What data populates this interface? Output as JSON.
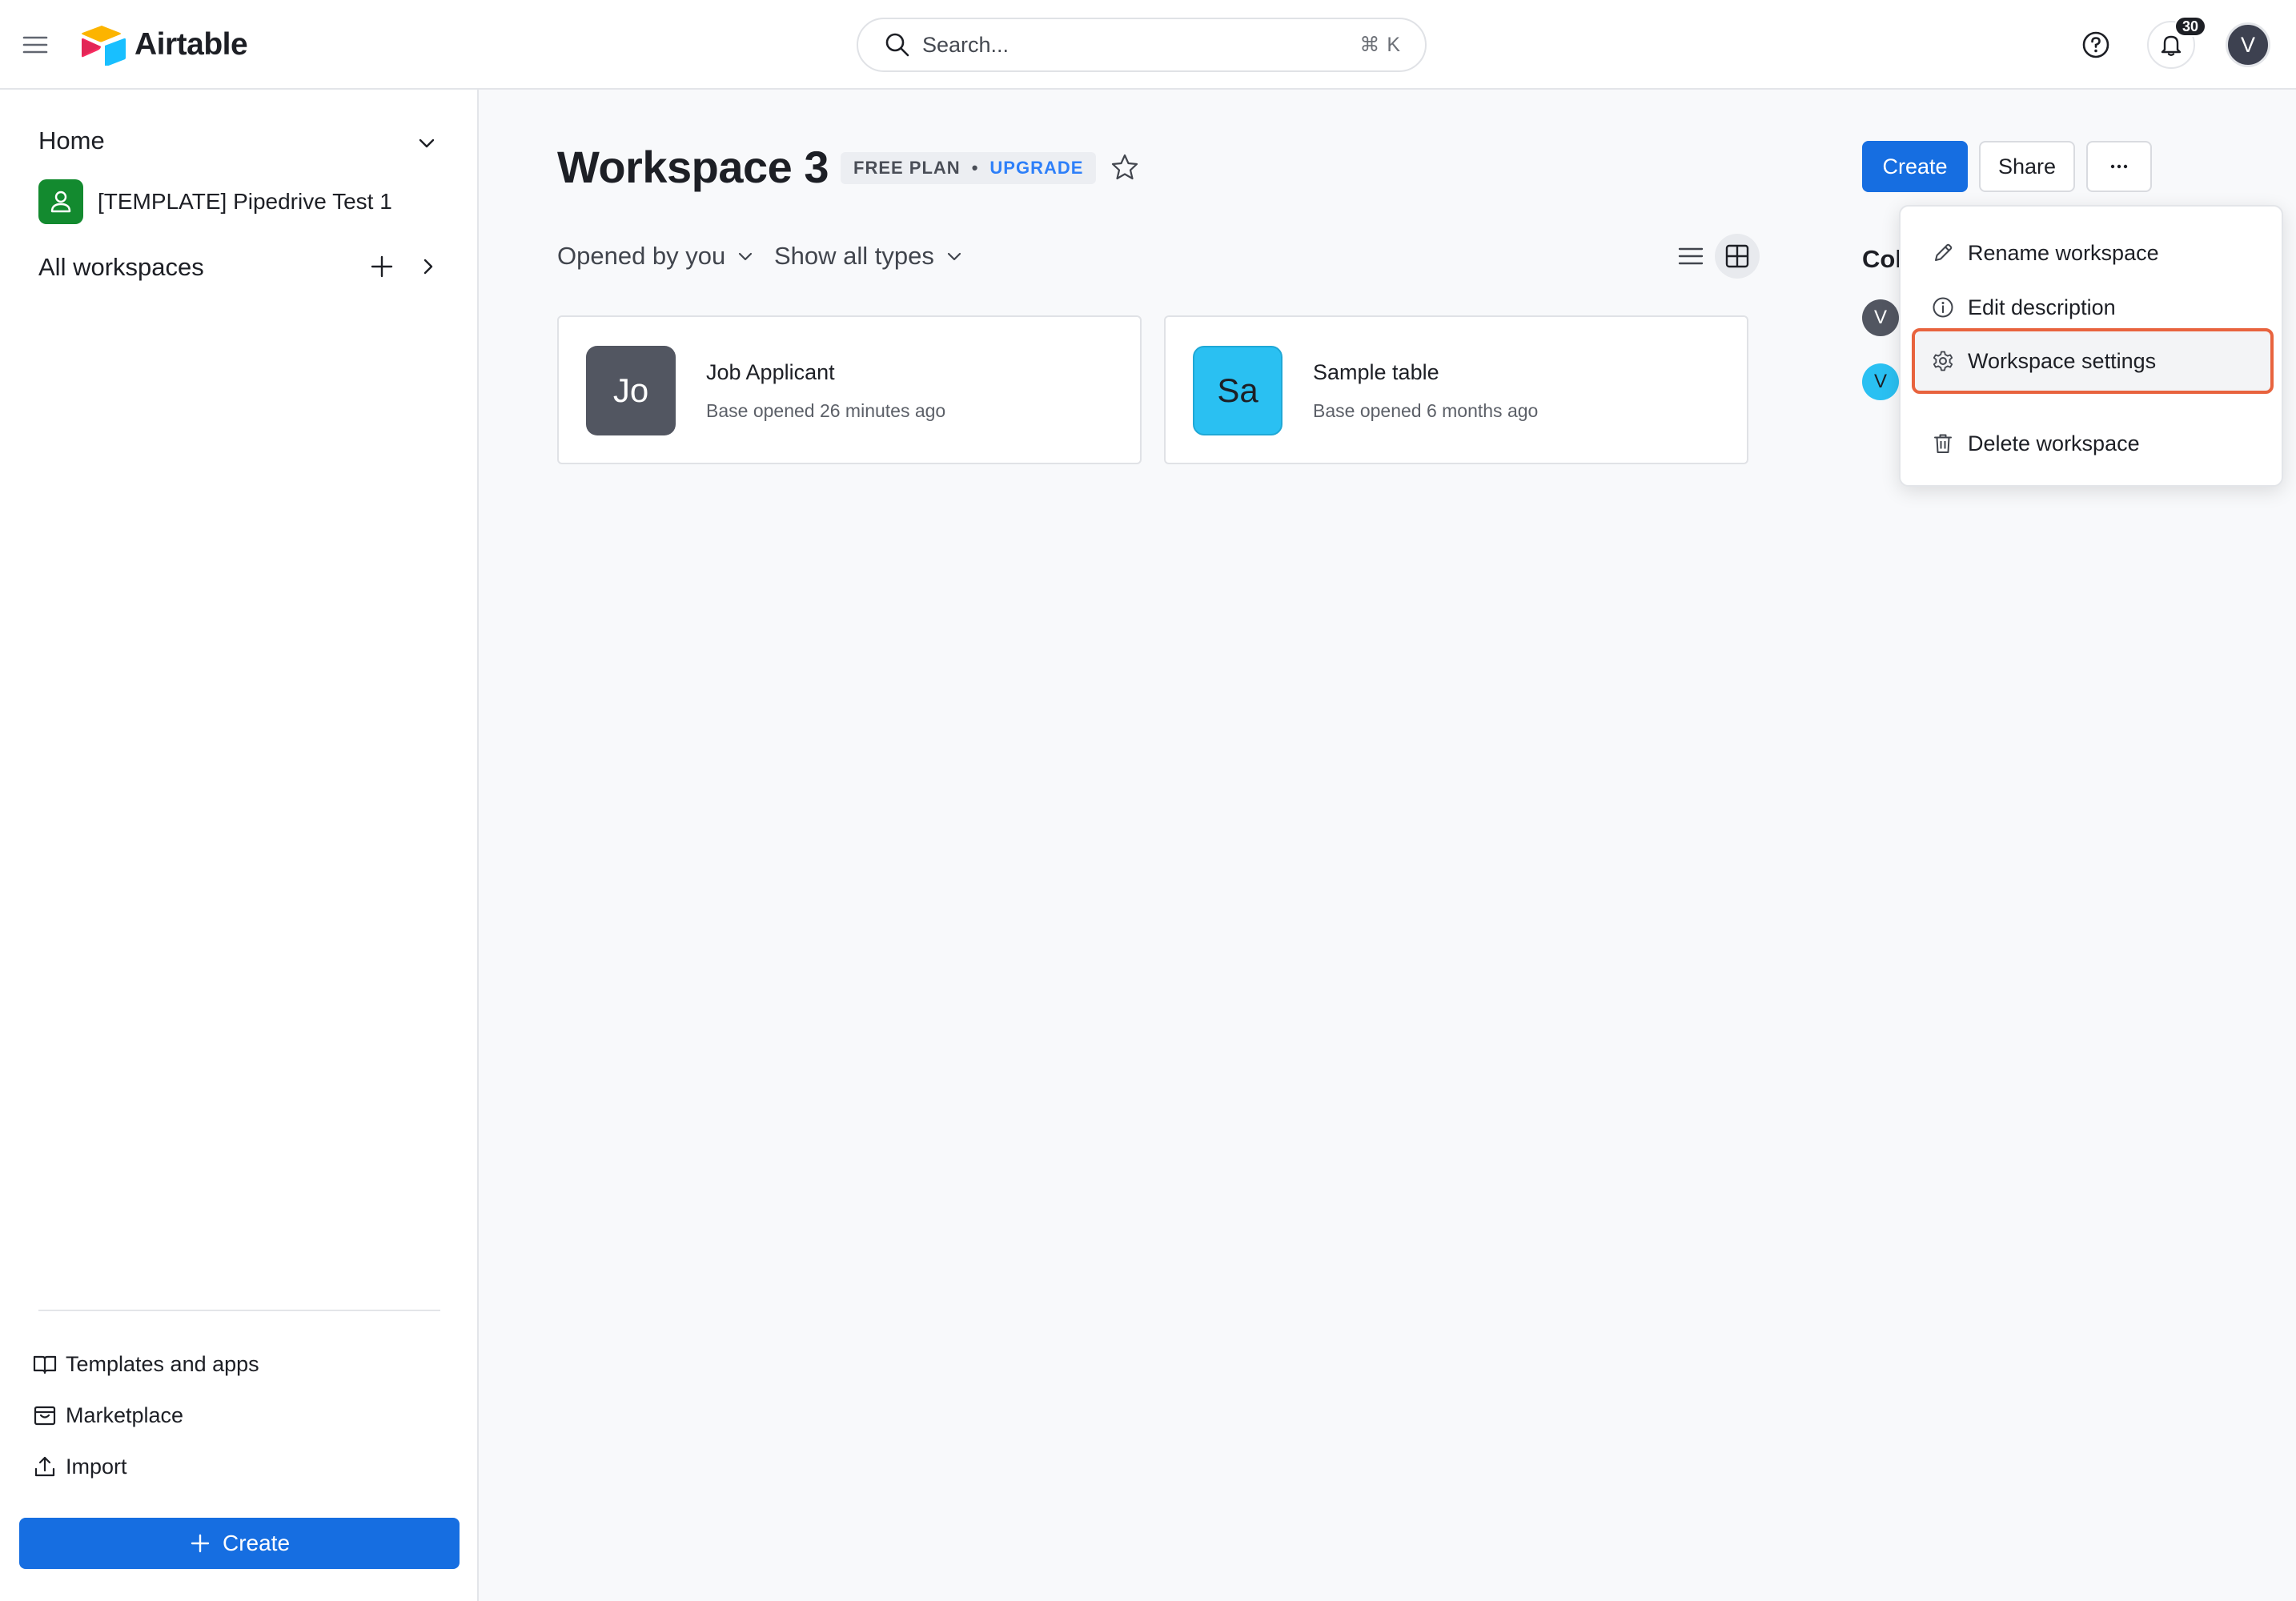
{
  "app": {
    "name": "Airtable",
    "accent_color": "#166ee1",
    "icons": {
      "menu": "hamburger-icon",
      "search": "search-icon",
      "help": "help-icon",
      "notifications": "bell-icon"
    }
  },
  "topbar": {
    "search_placeholder": "Search...",
    "search_shortcut": "⌘ K",
    "notification_count": "30",
    "user_initial": "V"
  },
  "sidebar": {
    "home_label": "Home",
    "bases": [
      {
        "label": "[TEMPLATE] Pipedrive Test 1",
        "icon_color": "#138a2f"
      }
    ],
    "all_workspaces_label": "All workspaces",
    "links": [
      {
        "label": "Templates and apps",
        "icon": "book-icon"
      },
      {
        "label": "Marketplace",
        "icon": "marketplace-icon"
      },
      {
        "label": "Import",
        "icon": "upload-icon"
      }
    ],
    "create_label": "Create"
  },
  "main": {
    "workspace_title": "Workspace 3",
    "plan_label": "FREE PLAN",
    "plan_separator": "•",
    "upgrade_label": "UPGRADE",
    "filters": {
      "opened_by": "Opened by you",
      "types": "Show all types"
    },
    "bases": [
      {
        "initials": "Jo",
        "name": "Job Applicant",
        "subtitle": "Base opened 26 minutes ago",
        "color": "#525661"
      },
      {
        "initials": "Sa",
        "name": "Sample table",
        "subtitle": "Base opened 6 months ago",
        "color": "#2ac0f2"
      }
    ],
    "actions": {
      "create": "Create",
      "share": "Share"
    },
    "collaborators_heading": "Col",
    "collaborators": [
      {
        "initial": "V",
        "color": "#525661"
      },
      {
        "initial": "V",
        "color": "#2ac0f2"
      }
    ]
  },
  "menu": {
    "items": [
      {
        "label": "Rename workspace",
        "icon": "pencil-icon"
      },
      {
        "label": "Edit description",
        "icon": "info-icon"
      },
      {
        "label": "Workspace settings",
        "icon": "gear-icon",
        "highlighted": true,
        "highlight_color": "#e8633e"
      },
      {
        "label": "Delete workspace",
        "icon": "trash-icon"
      }
    ]
  }
}
